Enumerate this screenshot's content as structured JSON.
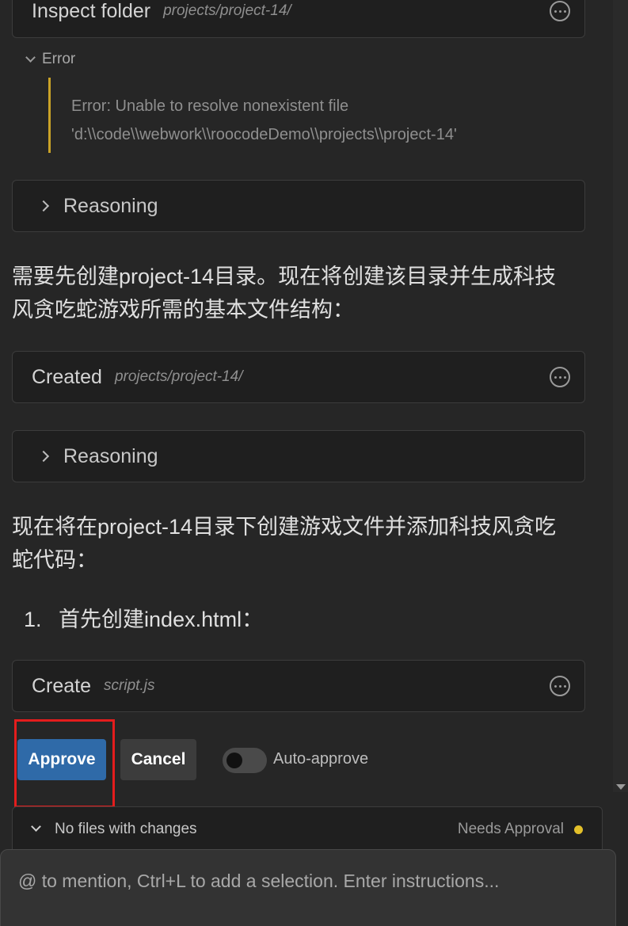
{
  "cards": {
    "inspect": {
      "verb": "Inspect folder",
      "path": "projects/project-14/"
    },
    "created": {
      "verb": "Created",
      "path": "projects/project-14/"
    },
    "create": {
      "verb": "Create",
      "path": "script.js"
    }
  },
  "error": {
    "label": "Error",
    "line1": "Error: Unable to resolve nonexistent file",
    "line2": "'d:\\\\code\\\\webwork\\\\roocodeDemo\\\\projects\\\\project-14'"
  },
  "reasoning": {
    "label": "Reasoning"
  },
  "messages": {
    "msg1_line1": "需要先创建project-14目录。现在将创建该目录并生成科技",
    "msg1_line2": "风贪吃蛇游戏所需的基本文件结构：",
    "msg2_line1": "现在将在project-14目录下创建游戏文件并添加科技风贪吃",
    "msg2_line2": "蛇代码："
  },
  "list": {
    "number": "1.",
    "text": "首先创建index.html："
  },
  "actions": {
    "approve": "Approve",
    "cancel": "Cancel",
    "auto_approve": "Auto-approve",
    "auto_approve_on": false
  },
  "changes": {
    "label": "No files with changes",
    "status": "Needs Approval",
    "status_color": "#e3c02a"
  },
  "input": {
    "placeholder": "@ to mention, Ctrl+L to add a selection. Enter instructions..."
  },
  "icons": {
    "more": "more-horizontal-circle-icon",
    "collapse": "chevron-down-icon",
    "expand": "chevron-right-icon"
  },
  "colors": {
    "approve_bg": "#2f6aa8",
    "error_border": "#c9a227",
    "highlight": "#e41d1d"
  }
}
